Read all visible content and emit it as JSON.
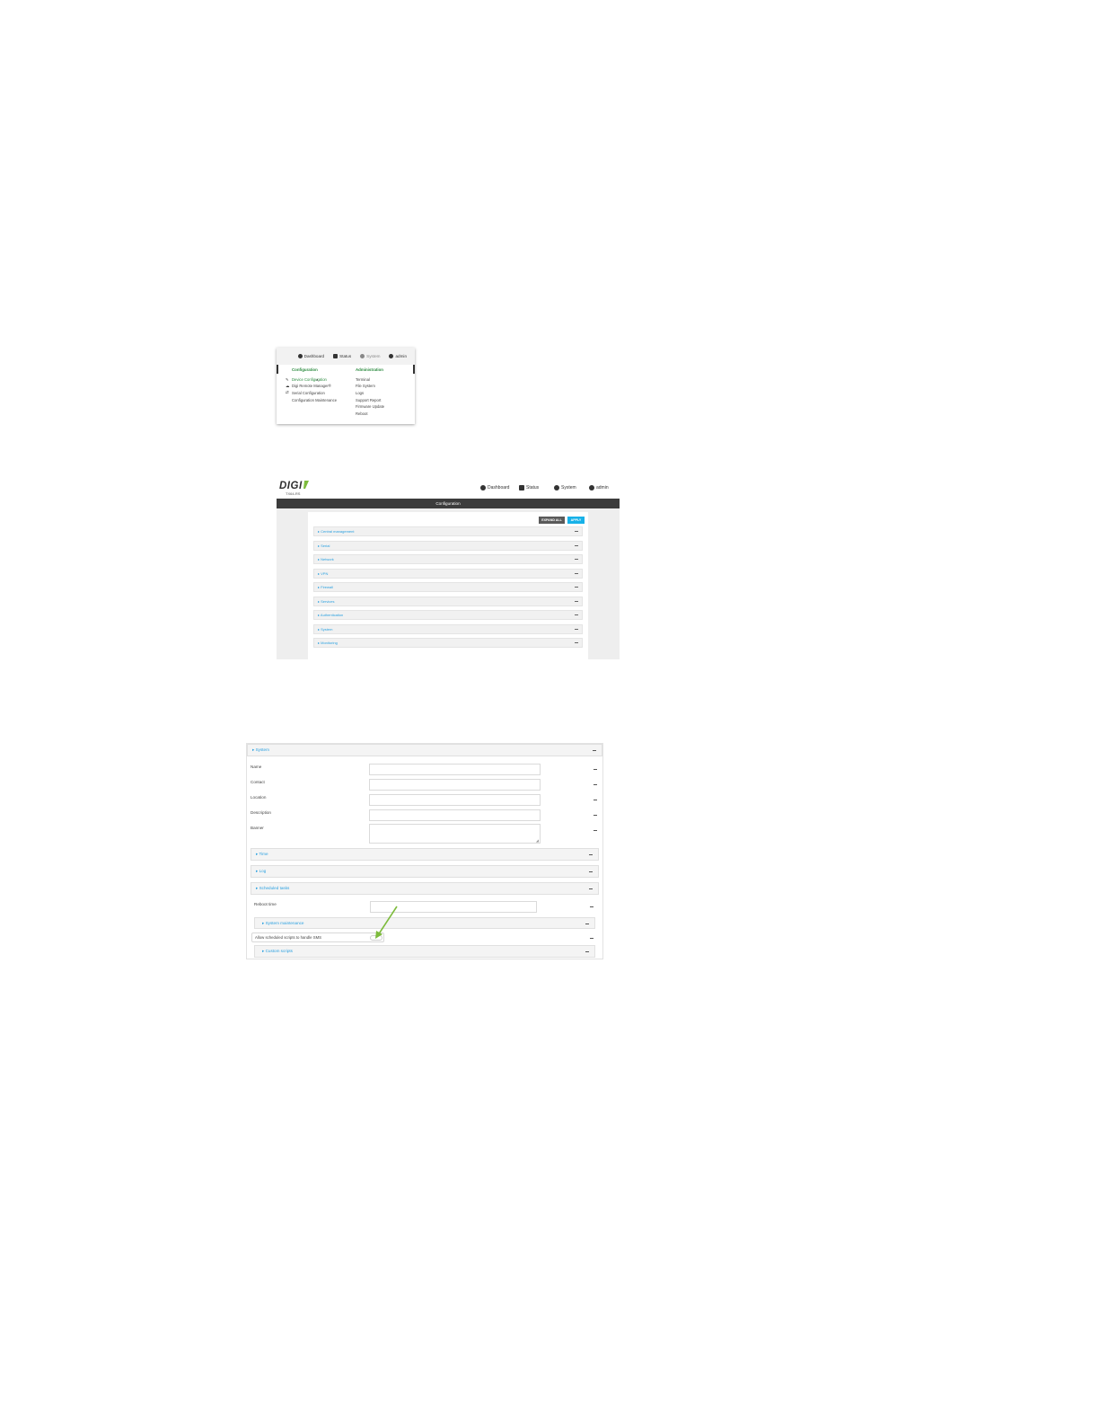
{
  "menu_shot": {
    "nav": {
      "dashboard": "Dashboard",
      "status": "Status",
      "system": "System",
      "admin": "admin"
    },
    "columns": {
      "configuration": {
        "heading": "Configuration",
        "items": [
          "Device Configuration",
          "Digi Remote Manager®",
          "Serial Configuration",
          "Configuration Maintenance"
        ]
      },
      "administration": {
        "heading": "Administration",
        "items": [
          "Terminal",
          "File System",
          "Logs",
          "Support Report",
          "Firmware Update",
          "Reboot"
        ]
      }
    }
  },
  "config_shot": {
    "logo": "DIGI",
    "logo_sub": "TX64-RS",
    "nav": {
      "dashboard": "Dashboard",
      "status": "Status",
      "system": "System",
      "admin": "admin"
    },
    "title": "Configuration",
    "buttons": {
      "expand_all": "EXPAND ALL",
      "apply": "APPLY"
    },
    "sections": [
      "Central management",
      "Serial",
      "Network",
      "VPN",
      "Firewall",
      "Services",
      "Authentication",
      "System",
      "Monitoring"
    ]
  },
  "system_shot": {
    "section_title": "System",
    "fields": {
      "name": "Name",
      "contact": "Contact",
      "location": "Location",
      "description": "Description",
      "banner": "Banner"
    },
    "subsections": {
      "time": "Time",
      "log": "Log",
      "scheduled_tasks": "Scheduled tasks"
    },
    "reboot_time": "Reboot time",
    "system_maintenance": "System maintenance",
    "allow_scripts": "Allow scheduled scripts to handle SMS",
    "allow_scripts_enabled": false,
    "custom_scripts": "Custom scripts"
  },
  "colors": {
    "link": "#2aa0e0",
    "apply": "#17b1e8",
    "header_dark": "#3c3c3c",
    "menu_heading": "#2a8a3e",
    "arrow": "#7dbb3c"
  }
}
